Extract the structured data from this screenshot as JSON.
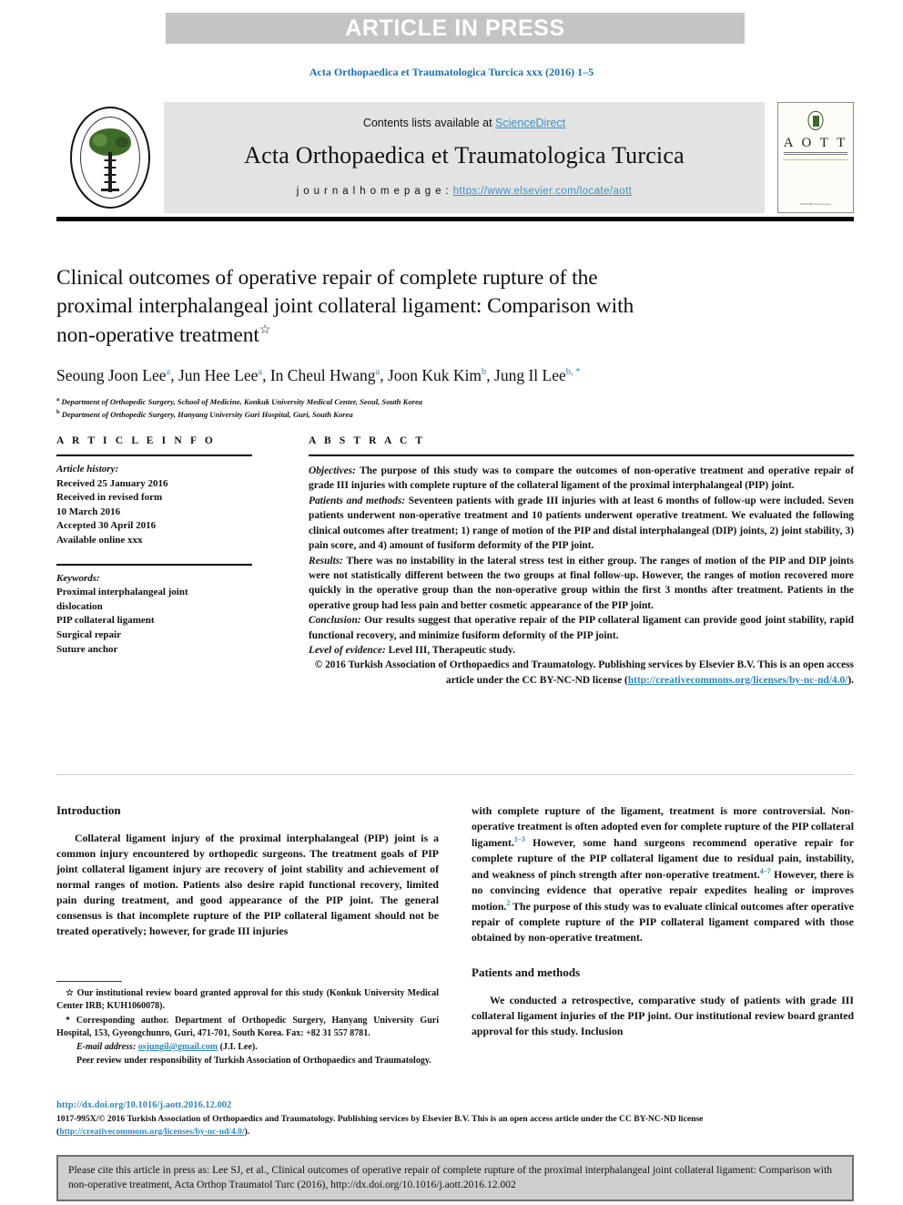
{
  "banner": {
    "label": "ARTICLE IN PRESS"
  },
  "running_head": "Acta Orthopaedica et Traumatologica Turcica xxx (2016) 1–5",
  "masthead": {
    "contents_prefix": "Contents lists available at ",
    "sciencedirect": "ScienceDirect",
    "journal_title": "Acta Orthopaedica et Traumatologica Turcica",
    "homepage_prefix": "j o u r n a l   h o m e p a g e :  ",
    "homepage_url": "https://www.elsevier.com/locate/aott",
    "cover_title": "A O T T",
    "cover_footer": "ELSEVIER\nwww.aott.org.tr",
    "logo_alt": "Acta Orthopaedica et Traumatologica Turcica emblem"
  },
  "article": {
    "title_line1": "Clinical outcomes of operative repair of complete rupture of the",
    "title_line2": "proximal interphalangeal joint collateral ligament: Comparison with",
    "title_line3": "non-operative treatment",
    "title_marker": "☆",
    "authors": [
      {
        "name": "Seoung Joon Lee",
        "sup": "a",
        "sep": ", "
      },
      {
        "name": "Jun Hee Lee",
        "sup": "a",
        "sep": ", "
      },
      {
        "name": "In Cheul Hwang",
        "sup": "a",
        "sep": ", "
      },
      {
        "name": "Joon Kuk Kim",
        "sup": "b",
        "sep": ", "
      },
      {
        "name": "Jung Il Lee",
        "sup": "b, *",
        "sep": ""
      }
    ],
    "affiliations": [
      {
        "marker": "a",
        "text": "Department of Orthopedic Surgery, School of Medicine, Konkuk University Medical Center, Seoul, South Korea"
      },
      {
        "marker": "b",
        "text": "Department of Orthopedic Surgery, Hanyang University Guri Hospital, Guri, South Korea"
      }
    ]
  },
  "article_info": {
    "heading": "A R T I C L E   I N F O",
    "history_label": "Article history:",
    "history": [
      "Received 25 January 2016",
      "Received in revised form",
      "10 March 2016",
      "Accepted 30 April 2016",
      "Available online xxx"
    ],
    "keywords_label": "Keywords:",
    "keywords": [
      "Proximal interphalangeal joint",
      "dislocation",
      "PIP collateral ligament",
      "Surgical repair",
      "Suture anchor"
    ]
  },
  "abstract": {
    "heading": "A B S T R A C T",
    "sections": [
      {
        "label": "Objectives:",
        "text": " The purpose of this study was to compare the outcomes of non-operative treatment and operative repair of grade III injuries with complete rupture of the collateral ligament of the proximal interphalangeal (PIP) joint."
      },
      {
        "label": "Patients and methods:",
        "text": " Seventeen patients with grade III injuries with at least 6 months of follow-up were included. Seven patients underwent non-operative treatment and 10 patients underwent operative treatment. We evaluated the following clinical outcomes after treatment; 1) range of motion of the PIP and distal interphalangeal (DIP) joints, 2) joint stability, 3) pain score, and 4) amount of fusiform deformity of the PIP joint."
      },
      {
        "label": "Results:",
        "text": " There was no instability in the lateral stress test in either group. The ranges of motion of the PIP and DIP joints were not statistically different between the two groups at final follow-up. However, the ranges of motion recovered more quickly in the operative group than the non-operative group within the first 3 months after treatment. Patients in the operative group had less pain and better cosmetic appearance of the PIP joint."
      },
      {
        "label": "Conclusion:",
        "text": " Our results suggest that operative repair of the PIP collateral ligament can provide good joint stability, rapid functional recovery, and minimize fusiform deformity of the PIP joint."
      },
      {
        "label": "Level of evidence:",
        "text": " Level III, Therapeutic study."
      }
    ],
    "copyright_text": "© 2016 Turkish Association of Orthopaedics and Traumatology. Publishing services by Elsevier B.V. This is an open access article under the CC BY-NC-ND license (",
    "copyright_link": "http://creativecommons.org/licenses/by-nc-nd/4.0/",
    "copyright_tail": ")."
  },
  "body": {
    "left": {
      "heading": "Introduction",
      "paragraph": "Collateral ligament injury of the proximal interphalangeal (PIP) joint is a common injury encountered by orthopedic surgeons. The treatment goals of PIP joint collateral ligament injury are recovery of joint stability and achievement of normal ranges of motion. Patients also desire rapid functional recovery, limited pain during treatment, and good appearance of the PIP joint. The general consensus is that incomplete rupture of the PIP collateral ligament should not be treated operatively; however, for grade III injuries"
    },
    "right": {
      "continued_paragraph_a": "with complete rupture of the ligament, treatment is more controversial. Non-operative treatment is often adopted even for complete rupture of the PIP collateral ligament.",
      "ref1": "1–3",
      "continued_paragraph_b": " However, some hand surgeons recommend operative repair for complete rupture of the PIP collateral ligament due to residual pain, instability, and weakness of pinch strength after non-operative treatment.",
      "ref2": "4–7",
      "continued_paragraph_c": " However, there is no convincing evidence that operative repair expedites healing or improves motion.",
      "ref3": "2",
      "continued_paragraph_d": " The purpose of this study was to evaluate clinical outcomes after operative repair of complete rupture of the PIP collateral ligament compared with those obtained by non-operative treatment.",
      "heading2": "Patients and methods",
      "paragraph2": "We conducted a retrospective, comparative study of patients with grade III collateral ligament injuries of the PIP joint. Our institutional review board granted approval for this study. Inclusion"
    }
  },
  "footnotes": [
    {
      "marker": "☆",
      "text": " Our institutional review board granted approval for this study (Konkuk University Medical Center IRB; KUH1060078)."
    },
    {
      "marker": "*",
      "text": " Corresponding author. Department of Orthopedic Surgery, Hanyang University Guri Hospital, 153, Gyeongchunro, Guri, 471-701, South Korea. Fax: +82 31 557 8781."
    }
  ],
  "footnote_email": {
    "label": "E-mail address:",
    "address": "osjungil@gmail.com",
    "owner": " (J.I. Lee)."
  },
  "footnote_peer": "Peer review under responsibility of Turkish Association of Orthopaedics and Traumatology.",
  "publisher": {
    "doi": "http://dx.doi.org/10.1016/j.aott.2016.12.002",
    "line_prefix": "1017-995X/© 2016 Turkish Association of Orthopaedics and Traumatology. Publishing services by Elsevier B.V. This is an open access article under the CC BY-NC-ND license (",
    "line_link": "http://creativecommons.org/licenses/by-nc-nd/4.0/",
    "line_tail": ")."
  },
  "citation_box": {
    "text": "Please cite this article in press as: Lee SJ, et al., Clinical outcomes of operative repair of complete rupture of the proximal interphalangeal joint collateral ligament: Comparison with non-operative treatment, Acta Orthop Traumatol Turc (2016), http://dx.doi.org/10.1016/j.aott.2016.12.002"
  },
  "colors": {
    "banner_bg": "#c4c4c4",
    "link_blue": "#2f86bb",
    "masthead_bg": "#e3e3e3",
    "cite_box_bg": "#cfcfcf"
  }
}
